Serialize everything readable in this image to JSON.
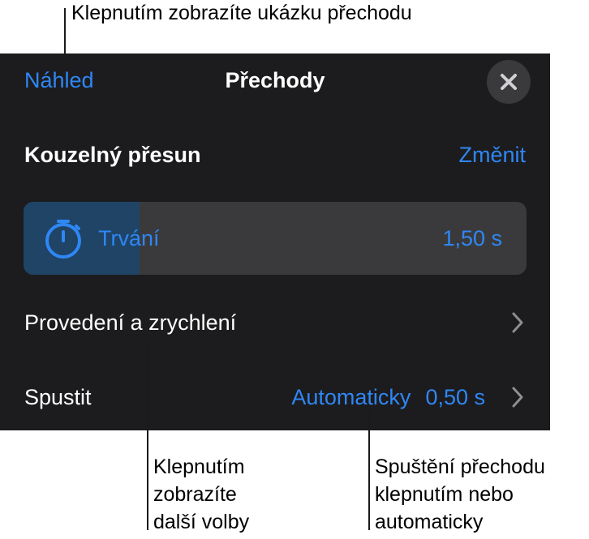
{
  "callouts": {
    "preview": "Klepnutím zobrazíte ukázku přechodu",
    "more_options": [
      "Klepnutím",
      "zobrazíte",
      "další volby"
    ],
    "start": [
      "Spuštění přechodu",
      "klepnutím nebo",
      "automaticky"
    ]
  },
  "panel": {
    "preview_label": "Náhled",
    "title": "Přechody",
    "close_icon": "close-icon",
    "transition_name": "Kouzelný přesun",
    "change_label": "Změnit",
    "duration": {
      "icon": "timer-icon",
      "label": "Trvání",
      "value": "1,50 s",
      "fill_fraction": 0.23
    },
    "delivery_label": "Provedení a zrychlení",
    "start": {
      "label": "Spustit",
      "mode": "Automaticky",
      "delay": "0,50 s"
    }
  },
  "colors": {
    "accent": "#2f87f5",
    "panel_background": "#1c1c1e",
    "control_background": "#3a3a3c",
    "slider_fill": "#1f4466"
  }
}
